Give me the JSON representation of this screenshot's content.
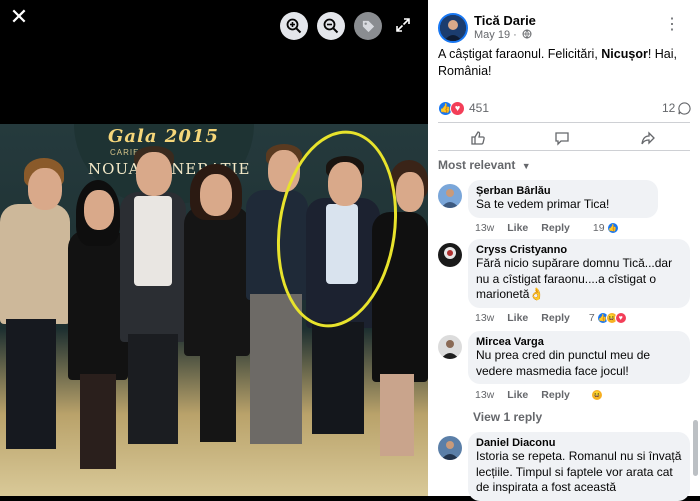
{
  "viewer": {
    "close_icon": "close-icon",
    "zoom_in_icon": "zoom-in-icon",
    "zoom_out_icon": "zoom-out-icon",
    "tag_icon": "tag-icon",
    "expand_icon": "expand-icon",
    "photo_banner": {
      "line1": "Gala 2015",
      "line2": "CARIERE",
      "line3": "NOUA GENERATIE"
    }
  },
  "post": {
    "author": "Tică Darie",
    "date": "May 19 ·",
    "text_before": "A câștigat faraonul. Felicitări, ",
    "text_bold": "Nicușor",
    "text_after": "! Hai, România!",
    "reaction_count": "451",
    "comment_count": "12",
    "sort_label": "Most relevant"
  },
  "comments": [
    {
      "name": "Șerban Bârlău",
      "text": "Sa te vedem primar Tica!",
      "time": "13w",
      "like": "Like",
      "reply": "Reply",
      "reactions": "19"
    },
    {
      "name": "Cryss Cristyanno",
      "text": "Fără nicio supărare domnu Tică...dar nu a cîstigat faraonu....a cîstigat o marionetă👌",
      "time": "13w",
      "like": "Like",
      "reply": "Reply",
      "reactions": "7"
    },
    {
      "name": "Mircea Varga",
      "text": "Nu prea cred din punctul meu de vedere masmedia face jocul!",
      "time": "13w",
      "like": "Like",
      "reply": "Reply",
      "reactions": ""
    },
    {
      "name": "Daniel Diaconu",
      "text": "Istoria se repeta. Romanul nu si învață lecțiile. Timpul si faptele vor arata cat de inspirata a fost această",
      "time": "",
      "like": "",
      "reply": "",
      "reactions": ""
    }
  ],
  "view_reply": "View 1 reply",
  "colors": {
    "like_blue": "#1877f2",
    "love_red": "#f33e58",
    "highlight_yellow": "#e8e32c"
  }
}
